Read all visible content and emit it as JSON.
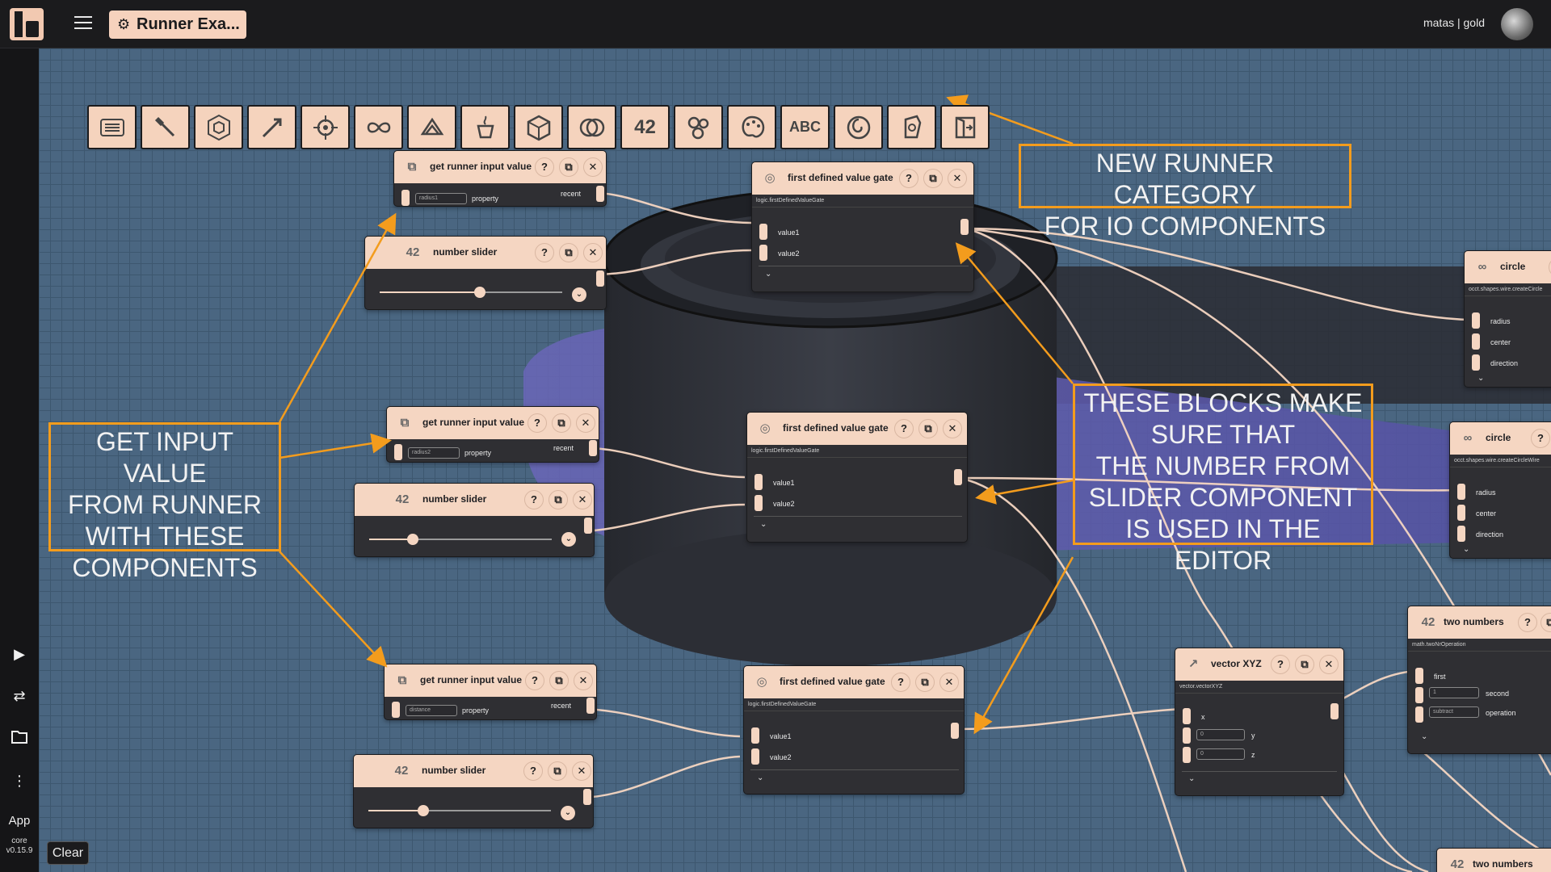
{
  "topbar": {
    "project_title": "Runner Exa...",
    "user": "matas | gold"
  },
  "sidebar": {
    "app_label": "App",
    "core_label": "core",
    "version": "v0.15.9",
    "icons": [
      "play-icon",
      "swap-icon",
      "folder-icon",
      "more-vertical-icon"
    ]
  },
  "toolbar": {
    "tools": [
      "text-lines-icon",
      "wrench-icon",
      "hexagon-icon",
      "arrow-icon",
      "target-icon",
      "infinity-icon",
      "triangle-icon",
      "cup-icon",
      "cube-icon",
      "rings-icon",
      "42",
      "cluster-icon",
      "palette-icon",
      "ABC",
      "spiral-icon",
      "io-shape-icon",
      "runner-icon"
    ]
  },
  "nodes": {
    "get_input_1": {
      "title": "get runner input value",
      "value": "radius1",
      "property_label": "property",
      "mode": "recent"
    },
    "get_input_2": {
      "title": "get runner input value",
      "value": "radius2",
      "property_label": "property",
      "mode": "recent"
    },
    "get_input_3": {
      "title": "get runner input value",
      "value": "distance",
      "property_label": "property",
      "mode": "recent"
    },
    "slider_1": {
      "title": "number slider",
      "icon_text": "42",
      "value": 0.55
    },
    "slider_2": {
      "title": "number slider",
      "icon_text": "42",
      "value": 0.24
    },
    "slider_3": {
      "title": "number slider",
      "icon_text": "42",
      "value": 0.3
    },
    "gate_1": {
      "title": "first defined value gate",
      "sub": "logic.firstDefinedValueGate",
      "in1": "value1",
      "in2": "value2"
    },
    "gate_2": {
      "title": "first defined value gate",
      "sub": "logic.firstDefinedValueGate",
      "in1": "value1",
      "in2": "value2"
    },
    "gate_3": {
      "title": "first defined value gate",
      "sub": "logic.firstDefinedValueGate",
      "in1": "value1",
      "in2": "value2"
    },
    "circle_1": {
      "title": "circle",
      "sub": "occt.shapes.wire.createCircle",
      "in1": "radius",
      "in2": "center",
      "in3": "direction"
    },
    "circle_2": {
      "title": "circle",
      "sub": "occt.shapes.wire.createCircleWire",
      "in1": "radius",
      "in2": "center",
      "in3": "direction"
    },
    "vector": {
      "title": "vector XYZ",
      "sub": "vector.vectorXYZ",
      "x": "x",
      "y": "y",
      "z": "z",
      "y_value": "0",
      "z_value": "0"
    },
    "two_numbers_1": {
      "title": "two numbers",
      "icon_text": "42",
      "sub": "math.twoNrOperation",
      "first": "first",
      "second": "second",
      "operation": "operation",
      "second_value": "1",
      "operation_value": "subtract"
    },
    "two_numbers_2": {
      "title": "two numbers",
      "icon_text": "42"
    }
  },
  "callouts": {
    "top": "NEW RUNNER CATEGORY\nFOR IO COMPONENTS",
    "left": "GET INPUT VALUE\nFROM RUNNER\nWITH THESE\nCOMPONENTS",
    "right": "THESE BLOCKS MAKE\nSURE THAT\nTHE NUMBER FROM\nSLIDER COMPONENT\nIS USED IN THE EDITOR"
  },
  "footer": {
    "clear_label": "Clear"
  },
  "colors": {
    "accent": "#f5d6c2",
    "callout": "#f39c1d",
    "canvas": "#4a6681",
    "wire": "#f5d6c2"
  }
}
